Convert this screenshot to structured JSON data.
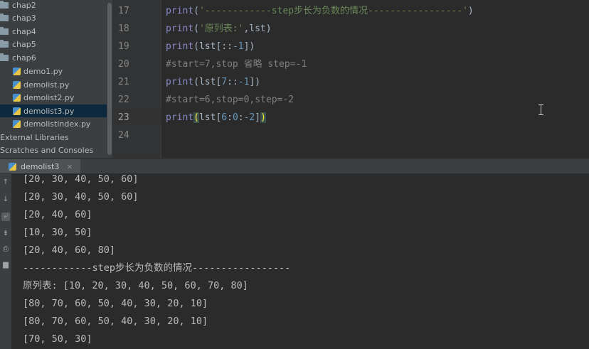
{
  "project_tree": {
    "items": [
      {
        "label": "chap2",
        "kind": "folder"
      },
      {
        "label": "chap3",
        "kind": "folder"
      },
      {
        "label": "chap4",
        "kind": "folder"
      },
      {
        "label": "chap5",
        "kind": "folder"
      },
      {
        "label": "chap6",
        "kind": "folder"
      },
      {
        "label": "demo1.py",
        "kind": "file"
      },
      {
        "label": "demolist.py",
        "kind": "file"
      },
      {
        "label": "demolist2.py",
        "kind": "file"
      },
      {
        "label": "demolist3.py",
        "kind": "file",
        "selected": true
      },
      {
        "label": "demolistindex.py",
        "kind": "file"
      },
      {
        "label": "External Libraries",
        "kind": "root"
      },
      {
        "label": "Scratches and Consoles",
        "kind": "root"
      }
    ]
  },
  "editor": {
    "current_line": 23,
    "lines": [
      {
        "num": "17",
        "parts": [
          [
            "kw",
            "print"
          ],
          [
            "p",
            "("
          ],
          [
            "str",
            "'------------step步长为负数的情况-----------------'"
          ],
          [
            "p",
            ")"
          ]
        ]
      },
      {
        "num": "18",
        "parts": [
          [
            "kw",
            "print"
          ],
          [
            "p",
            "("
          ],
          [
            "str",
            "'原列表:'"
          ],
          [
            "p",
            ",lst)"
          ]
        ]
      },
      {
        "num": "19",
        "parts": [
          [
            "kw",
            "print"
          ],
          [
            "p",
            "(lst[::"
          ],
          [
            "num",
            "-1"
          ],
          [
            "p",
            "])"
          ]
        ]
      },
      {
        "num": "20",
        "parts": [
          [
            "cmt",
            "#start=7,stop 省略 step=-1"
          ]
        ]
      },
      {
        "num": "21",
        "parts": [
          [
            "kw",
            "print"
          ],
          [
            "p",
            "(lst["
          ],
          [
            "num",
            "7"
          ],
          [
            "p",
            "::"
          ],
          [
            "num",
            "-1"
          ],
          [
            "p",
            "])"
          ]
        ]
      },
      {
        "num": "22",
        "parts": [
          [
            "cmt",
            "#start=6,stop=0,step=-2"
          ]
        ]
      },
      {
        "num": "23",
        "parts": [
          [
            "kw",
            "print"
          ],
          [
            "brk",
            "("
          ],
          [
            "p",
            "lst["
          ],
          [
            "num",
            "6"
          ],
          [
            "p",
            ":"
          ],
          [
            "num",
            "0"
          ],
          [
            "p",
            ":"
          ],
          [
            "num",
            "-2"
          ],
          [
            "p",
            "]"
          ],
          [
            "brk",
            ")"
          ]
        ]
      },
      {
        "num": "24",
        "parts": []
      }
    ]
  },
  "run": {
    "tab_label": "demolist3",
    "close_glyph": "×",
    "output": [
      "[20, 30, 40, 50, 60]",
      "[20, 30, 40, 50, 60]",
      "[20, 40, 60]",
      "[10, 30, 50]",
      "[20, 40, 60, 80]",
      "------------step步长为负数的情况-----------------",
      "原列表: [10, 20, 30, 40, 50, 60, 70, 80]",
      "[80, 70, 60, 50, 40, 30, 20, 10]",
      "[80, 70, 60, 50, 40, 30, 20, 10]",
      "[70, 50, 30]"
    ]
  },
  "run_side_icons": [
    "up-arrow-icon",
    "down-arrow-icon",
    "wrap-icon",
    "sort-icon",
    "print-icon",
    "trash-icon"
  ],
  "colors": {
    "keyword": "#8888c6",
    "string": "#6a8759",
    "number": "#6897bb",
    "comment": "#808080",
    "selected_row": "#0d293e"
  }
}
